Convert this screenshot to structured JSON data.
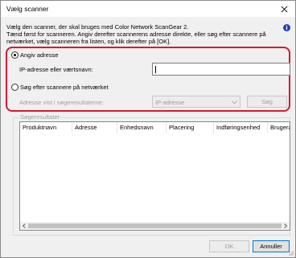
{
  "window": {
    "title": "Vælg scanner"
  },
  "intro": {
    "line1": "Vælg den scanner, der skal bruges med Color Network ScanGear 2.",
    "line2": "Tænd først for scanneren. Angiv derefter scannerens adresse direkte, eller søg efter scannere på netværket, vælg scanneren fra listen, og klik derefter på [OK]."
  },
  "address_option": {
    "label": "Angiv adresse",
    "selected": true,
    "field_label": "IP-adresse eller værtsnavn:",
    "value": ""
  },
  "search_option": {
    "label": "Søg efter scannere på netværket",
    "selected": false,
    "address_label": "Adresse vist i søgeresultaterne:",
    "address_type": "IP-adresse",
    "search_button": "Søg"
  },
  "results": {
    "label": "Søgeresultater",
    "columns": [
      "Produktnavn",
      "Adresse",
      "Enhedsnavn",
      "Placering",
      "Indføringsenhed",
      "Brugeradr"
    ],
    "rows": []
  },
  "buttons": {
    "ok": "OK",
    "cancel": "Annuller"
  },
  "colors": {
    "highlight": "#d7192f",
    "accent": "#0078d7",
    "info": "#1f3fbf"
  },
  "icons": {
    "close": "close-icon",
    "help": "info-icon",
    "dropdown": "chevron-down-icon"
  }
}
